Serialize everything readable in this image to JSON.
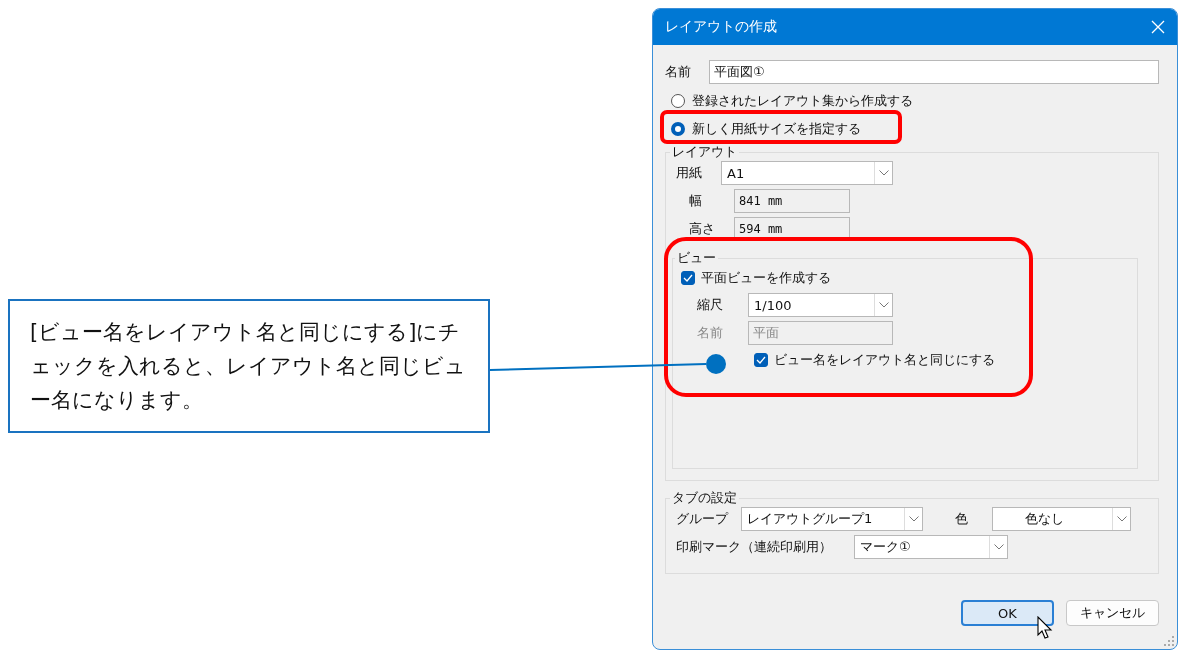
{
  "callout": {
    "text": "[ビュー名をレイアウト名と同じにする]にチェックを入れると、レイアウト名と同じビュー名になります。"
  },
  "dialog": {
    "title": "レイアウトの作成",
    "name_field": {
      "label": "名前",
      "value": "平面図①"
    },
    "source_options": [
      {
        "label": "登録されたレイアウト集から作成する",
        "selected": false
      },
      {
        "label": "新しく用紙サイズを指定する",
        "selected": true
      }
    ],
    "layout_group": {
      "title": "レイアウト",
      "paper": {
        "label": "用紙",
        "value": "A1"
      },
      "width": {
        "label": "幅",
        "value": "841 mm"
      },
      "height": {
        "label": "高さ",
        "value": "594 mm"
      },
      "view_group": {
        "title": "ビュー",
        "create_plan_view": {
          "label": "平面ビューを作成する",
          "checked": true
        },
        "scale": {
          "label": "縮尺",
          "value": "1/100"
        },
        "view_name": {
          "label": "名前",
          "value": "平面",
          "disabled": true
        },
        "same_name": {
          "label": "ビュー名をレイアウト名と同じにする",
          "checked": true
        }
      }
    },
    "tab_settings": {
      "title": "タブの設定",
      "group": {
        "label": "グループ",
        "value": "レイアウトグループ1"
      },
      "color": {
        "label": "色",
        "value": "色なし"
      },
      "print_mark": {
        "label": "印刷マーク（連続印刷用）",
        "value": "マーク①"
      }
    },
    "buttons": [
      {
        "label": "OK",
        "focused": true
      },
      {
        "label": "キャンセル",
        "focused": false
      }
    ]
  }
}
